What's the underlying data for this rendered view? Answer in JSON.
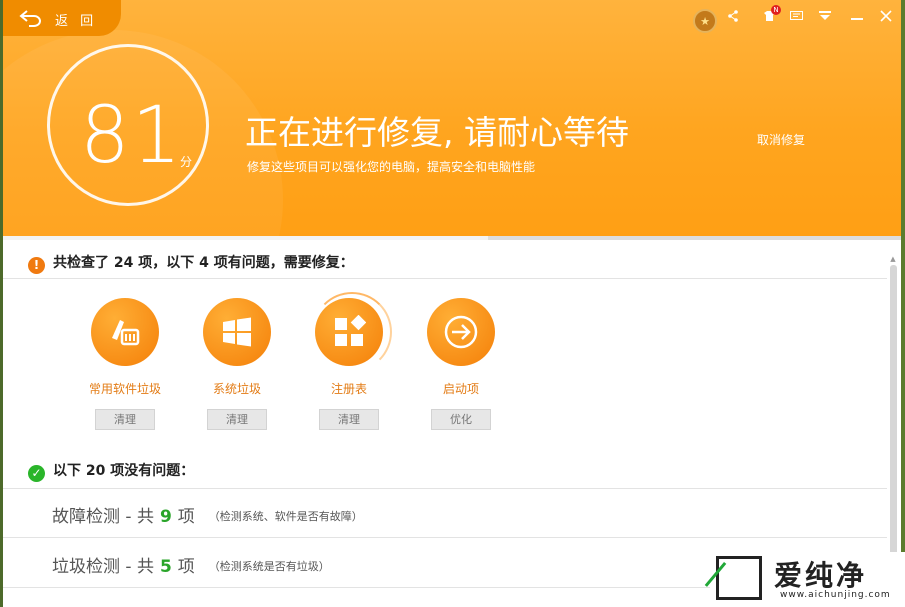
{
  "header": {
    "back_label": "返 回",
    "score": "81",
    "score_unit": "分",
    "status_title": "正在进行修复, 请耐心等待",
    "status_subtitle": "修复这些项目可以强化您的电脑，提高安全和电脑性能",
    "cancel_label": "取消修复",
    "notification_badge": "N",
    "repair_progress": 0.54
  },
  "toolbar_icons": [
    "medal-icon",
    "share-icon",
    "skin-icon",
    "message-icon",
    "menu-icon",
    "minimize-icon",
    "close-icon"
  ],
  "problems": {
    "heading": "共检查了 24 项，以下 4 项有问题，需要修复：",
    "items": [
      {
        "label": "常用软件垃圾",
        "action": "清理",
        "icon": "software-trash-icon"
      },
      {
        "label": "系统垃圾",
        "action": "清理",
        "icon": "windows-logo-icon"
      },
      {
        "label": "注册表",
        "action": "清理",
        "icon": "registry-icon"
      },
      {
        "label": "启动项",
        "action": "优化",
        "icon": "startup-arrow-icon"
      }
    ]
  },
  "ok": {
    "heading": "以下 20 项没有问题：",
    "rows": [
      {
        "prefix": "故障检测 - 共",
        "count": "9",
        "suffix": "项",
        "note": "（检测系统、软件是否有故障）"
      },
      {
        "prefix": "垃圾检测 - 共",
        "count": "5",
        "suffix": "项",
        "note": "（检测系统是否有垃圾）"
      }
    ]
  },
  "watermark": {
    "text": "爱纯净",
    "url": "www.aichunjing.com"
  },
  "colors": {
    "accent_orange": "#ffa51f",
    "ok_green": "#2aa52a",
    "warn_orange": "#f07a10"
  }
}
